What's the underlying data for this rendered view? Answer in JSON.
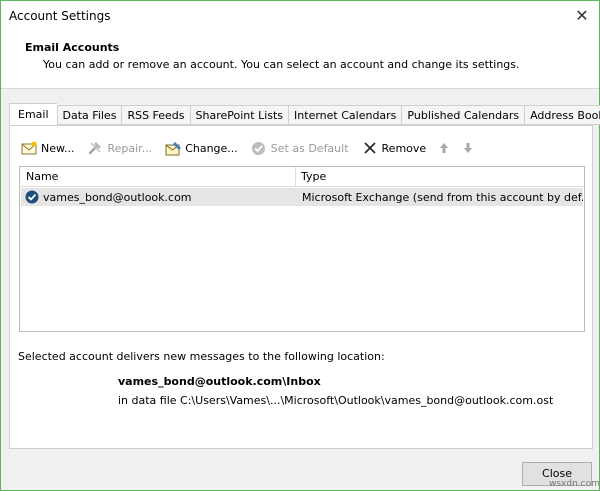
{
  "window": {
    "title": "Account Settings",
    "close_glyph": "✕"
  },
  "header": {
    "title": "Email Accounts",
    "subtitle": "You can add or remove an account. You can select an account and change its settings."
  },
  "tabs": [
    {
      "label": "Email",
      "active": true
    },
    {
      "label": "Data Files",
      "active": false
    },
    {
      "label": "RSS Feeds",
      "active": false
    },
    {
      "label": "SharePoint Lists",
      "active": false
    },
    {
      "label": "Internet Calendars",
      "active": false
    },
    {
      "label": "Published Calendars",
      "active": false
    },
    {
      "label": "Address Books",
      "active": false
    }
  ],
  "toolbar": {
    "new_label": "New...",
    "repair_label": "Repair...",
    "change_label": "Change...",
    "set_default_label": "Set as Default",
    "remove_label": "Remove"
  },
  "account_list": {
    "columns": [
      "Name",
      "Type"
    ],
    "rows": [
      {
        "name": "vames_bond@outlook.com",
        "type": "Microsoft Exchange (send from this account by def..."
      }
    ]
  },
  "delivery": {
    "label": "Selected account delivers new messages to the following location:",
    "location": "vames_bond@outlook.com\\Inbox",
    "file": "in data file C:\\Users\\Vames\\...\\Microsoft\\Outlook\\vames_bond@outlook.com.ost"
  },
  "footer": {
    "close_label": "Close"
  },
  "watermark": "wsxdn.com",
  "colors": {
    "window_border": "#5cb85c",
    "selected_row": "#e5e5e5",
    "check_icon": "#1f4e79",
    "disabled_text": "#9a9a9a"
  }
}
